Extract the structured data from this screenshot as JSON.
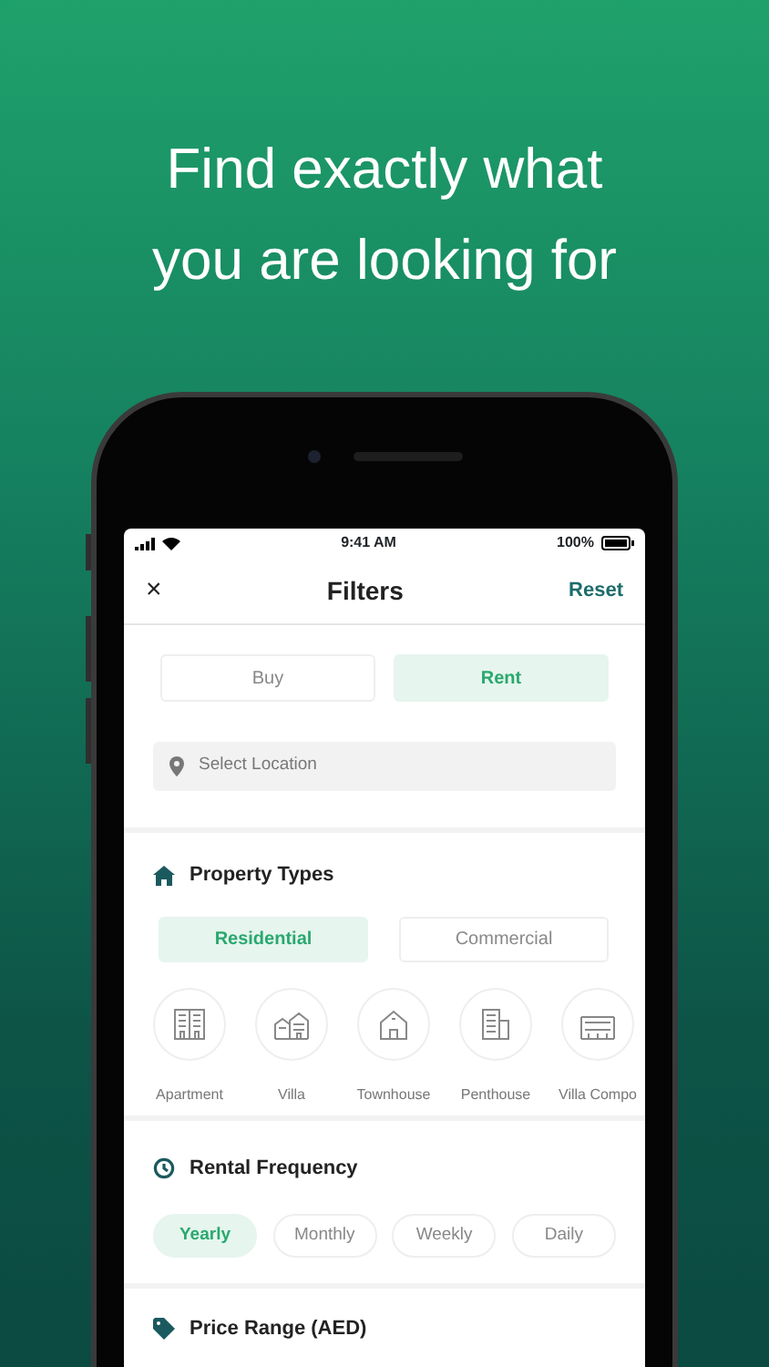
{
  "headline": [
    "Find exactly what",
    "you are looking for"
  ],
  "status_bar": {
    "time": "9:41 AM",
    "battery": "100%"
  },
  "nav": {
    "close": "×",
    "title": "Filters",
    "action": "Reset"
  },
  "listing_type": [
    {
      "label": "Buy",
      "selected": false
    },
    {
      "label": "Rent",
      "selected": true
    }
  ],
  "location": {
    "placeholder": "Select Location"
  },
  "property_types": {
    "title": "Property Types",
    "tabs": [
      {
        "label": "Residential",
        "selected": true
      },
      {
        "label": "Commercial",
        "selected": false
      }
    ],
    "types": [
      {
        "label": "Apartment",
        "kind": "apartment"
      },
      {
        "label": "Villa",
        "kind": "villa"
      },
      {
        "label": "Townhouse",
        "kind": "townhouse"
      },
      {
        "label": "Penthouse",
        "kind": "penthouse"
      },
      {
        "label": "Villa Compo",
        "kind": "compound"
      }
    ]
  },
  "rental_frequency": {
    "title": "Rental Frequency",
    "options": [
      {
        "label": "Yearly",
        "selected": true
      },
      {
        "label": "Monthly",
        "selected": false
      },
      {
        "label": "Weekly",
        "selected": false
      },
      {
        "label": "Daily",
        "selected": false
      }
    ]
  },
  "price_range": {
    "title": "Price Range (AED)"
  }
}
